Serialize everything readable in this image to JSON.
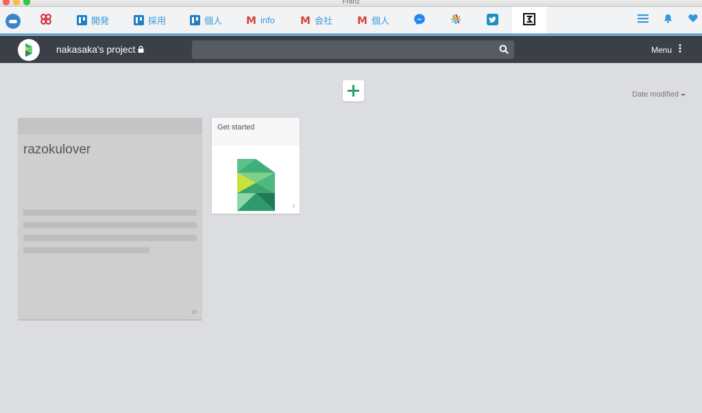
{
  "window": {
    "title": "Franz"
  },
  "services": [
    {
      "name": "",
      "icon": "clover-icon"
    },
    {
      "name": "開発",
      "icon": "trello-icon"
    },
    {
      "name": "採用",
      "icon": "trello-icon"
    },
    {
      "name": "個人",
      "icon": "trello-icon"
    },
    {
      "name": "info",
      "icon": "gmail-icon"
    },
    {
      "name": "会社",
      "icon": "gmail-icon"
    },
    {
      "name": "個人",
      "icon": "gmail-icon"
    },
    {
      "name": "",
      "icon": "messenger-icon"
    },
    {
      "name": "",
      "icon": "slack-icon"
    },
    {
      "name": "",
      "icon": "twitter-icon"
    },
    {
      "name": "",
      "icon": "scrapbox-icon",
      "active": true
    }
  ],
  "service_icons": {
    "gmail_glyph": "M"
  },
  "colors": {
    "franz_blue": "#3498db",
    "header_dark": "#3a3f48",
    "accent_green": "#2e9e6e"
  },
  "header": {
    "project_title": "nakasaka's project",
    "search_placeholder": "",
    "menu_label": "Menu"
  },
  "toolbar": {
    "sort_label": "Date modified"
  },
  "pages": [
    {
      "title": "razokulover",
      "count": "10"
    },
    {
      "title": "Get started",
      "count": "3"
    }
  ]
}
